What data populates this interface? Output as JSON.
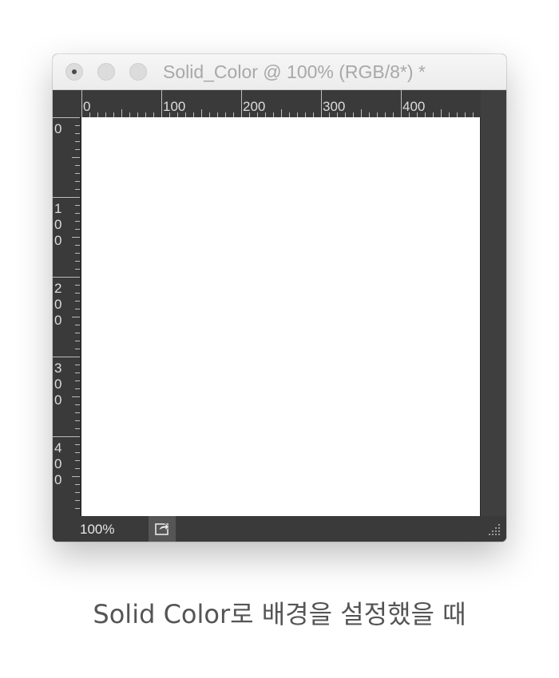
{
  "window": {
    "title": "Solid_Color @ 100% (RGB/8*) *"
  },
  "rulers": {
    "units": "px",
    "top_labels": [
      "0",
      "100",
      "200",
      "300",
      "400"
    ],
    "left_labels": [
      "0",
      "100",
      "200",
      "300",
      "400"
    ]
  },
  "canvas": {
    "fill_color": "#ffffff"
  },
  "statusbar": {
    "zoom": "100%",
    "share_icon": "share-icon"
  },
  "caption": "Solid Color로 배경을 설정했을 때",
  "colors": {
    "chrome_dark": "#3a3a3a",
    "titlebar": "#ececec",
    "title_text": "#a8a8a8"
  }
}
